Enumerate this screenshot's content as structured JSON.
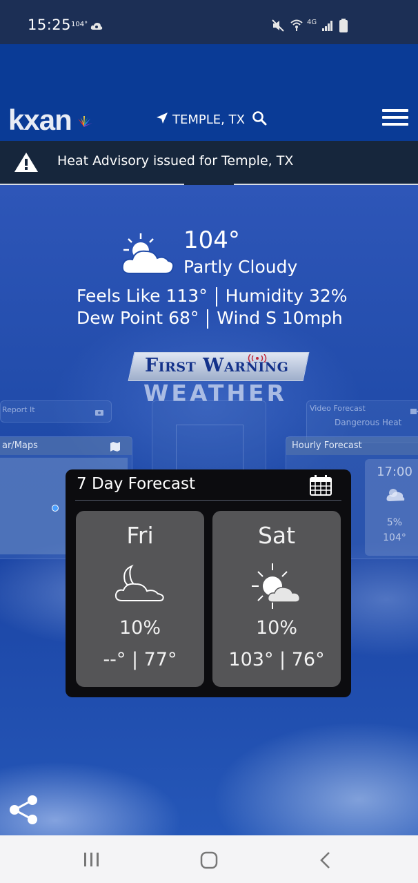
{
  "status_bar": {
    "time": "15:25",
    "temp": "104°",
    "network": "4G",
    "icons": [
      "weather-cloud-icon",
      "mute-icon",
      "wifi-icon",
      "signal-icon",
      "battery-icon"
    ]
  },
  "header": {
    "logo_text": "kxan",
    "location": "TEMPLE, TX",
    "icons": [
      "location-arrow-icon",
      "search-icon",
      "menu-icon"
    ]
  },
  "alert": {
    "text": "Heat Advisory issued for Temple, TX",
    "icon": "warning-icon"
  },
  "current": {
    "temp": "104°",
    "condition": "Partly Cloudy",
    "feels_like_label": "Feels Like",
    "feels_like": "113°",
    "humidity_label": "Humidity",
    "humidity": "32%",
    "dew_point_label": "Dew Point",
    "dew_point": "68°",
    "wind_label": "Wind",
    "wind": "S 10mph"
  },
  "brand": {
    "top": "First Warning",
    "bottom": "WEATHER"
  },
  "background_cards": {
    "report_it": "Report It",
    "maps": "ar/Maps",
    "video_forecast": "Video Forecast",
    "video_sub": "Dangerous Heat",
    "hourly_forecast": "Hourly Forecast",
    "hourly_time": "17:00",
    "hourly_precip": "5%",
    "hourly_temp": "104°"
  },
  "forecast": {
    "title": "7 Day Forecast",
    "days": [
      {
        "name": "Fri",
        "icon": "moon-cloud-icon",
        "precip": "10%",
        "temps": "--° | 77°"
      },
      {
        "name": "Sat",
        "icon": "sun-cloud-icon",
        "precip": "10%",
        "temps": "103° | 76°"
      }
    ]
  },
  "colors": {
    "header_blue": "#0a3b96",
    "alert_bg": "#16263c",
    "card_bg": "#0c0c0f",
    "day_box": "#555557"
  }
}
